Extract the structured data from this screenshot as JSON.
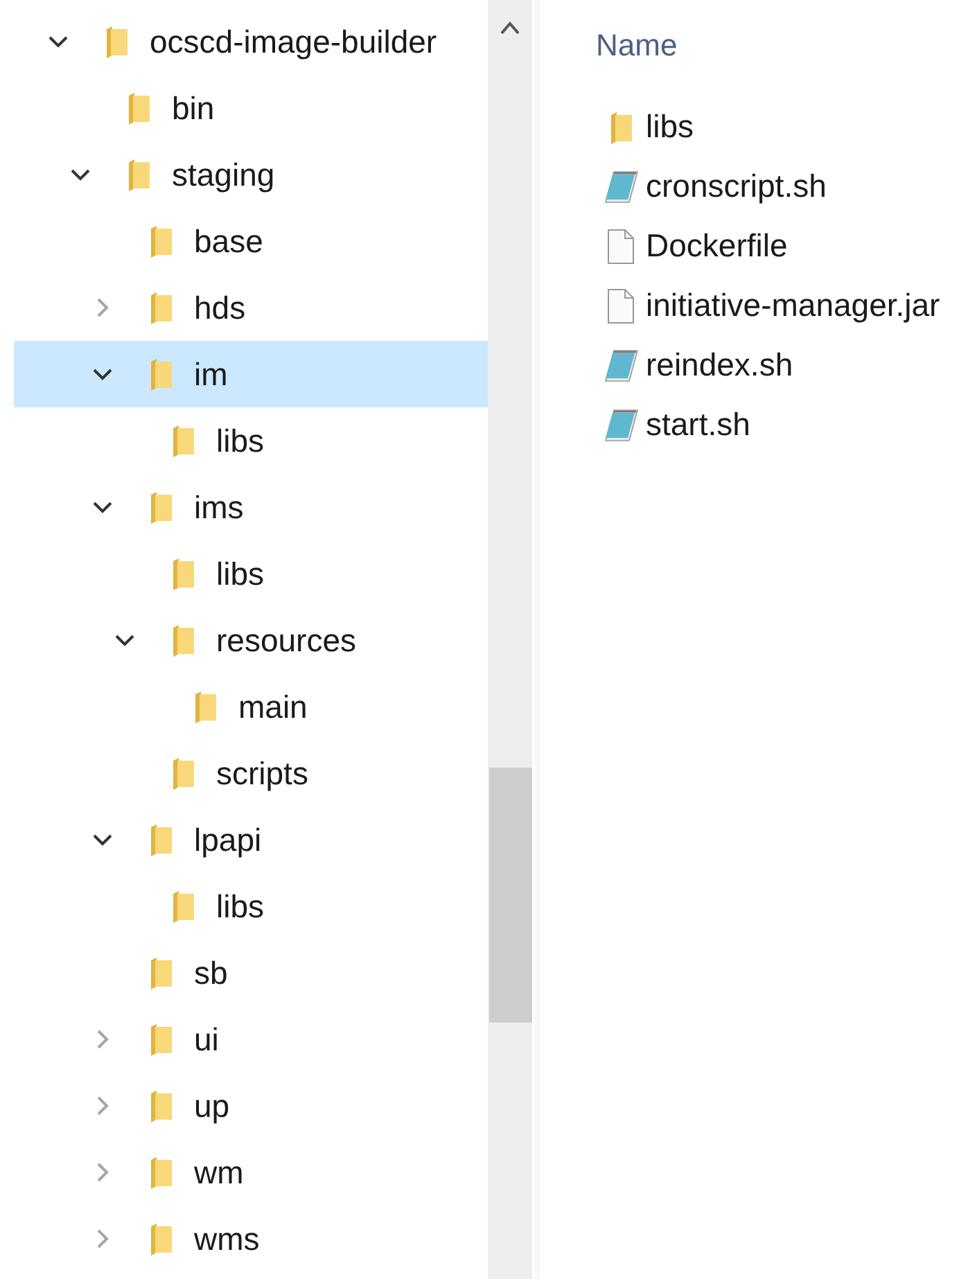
{
  "navigation_tree": [
    {
      "label": "ocscd-image-builder",
      "expandable": true,
      "expanded": true,
      "selected": false,
      "children": [
        {
          "label": "bin",
          "expandable": false,
          "selected": false
        },
        {
          "label": "staging",
          "expandable": true,
          "expanded": true,
          "selected": false,
          "children": [
            {
              "label": "base",
              "expandable": false,
              "selected": false
            },
            {
              "label": "hds",
              "expandable": true,
              "expanded": false,
              "selected": false
            },
            {
              "label": "im",
              "expandable": true,
              "expanded": true,
              "selected": true,
              "children": [
                {
                  "label": "libs",
                  "expandable": false,
                  "selected": false
                }
              ]
            },
            {
              "label": "ims",
              "expandable": true,
              "expanded": true,
              "selected": false,
              "children": [
                {
                  "label": "libs",
                  "expandable": false,
                  "selected": false
                },
                {
                  "label": "resources",
                  "expandable": true,
                  "expanded": true,
                  "selected": false,
                  "children": [
                    {
                      "label": "main",
                      "expandable": false,
                      "selected": false
                    }
                  ]
                },
                {
                  "label": "scripts",
                  "expandable": false,
                  "selected": false
                }
              ]
            },
            {
              "label": "lpapi",
              "expandable": true,
              "expanded": true,
              "selected": false,
              "children": [
                {
                  "label": "libs",
                  "expandable": false,
                  "selected": false
                }
              ]
            },
            {
              "label": "sb",
              "expandable": false,
              "selected": false
            },
            {
              "label": "ui",
              "expandable": true,
              "expanded": false,
              "selected": false
            },
            {
              "label": "up",
              "expandable": true,
              "expanded": false,
              "selected": false
            },
            {
              "label": "wm",
              "expandable": true,
              "expanded": false,
              "selected": false
            },
            {
              "label": "wms",
              "expandable": true,
              "expanded": false,
              "selected": false
            }
          ]
        }
      ]
    }
  ],
  "file_list": {
    "column_header": "Name",
    "items": [
      {
        "name": "libs",
        "kind": "folder"
      },
      {
        "name": "cronscript.sh",
        "kind": "script"
      },
      {
        "name": "Dockerfile",
        "kind": "file"
      },
      {
        "name": "initiative-manager.jar",
        "kind": "file"
      },
      {
        "name": "reindex.sh",
        "kind": "script"
      },
      {
        "name": "start.sh",
        "kind": "script"
      }
    ]
  }
}
